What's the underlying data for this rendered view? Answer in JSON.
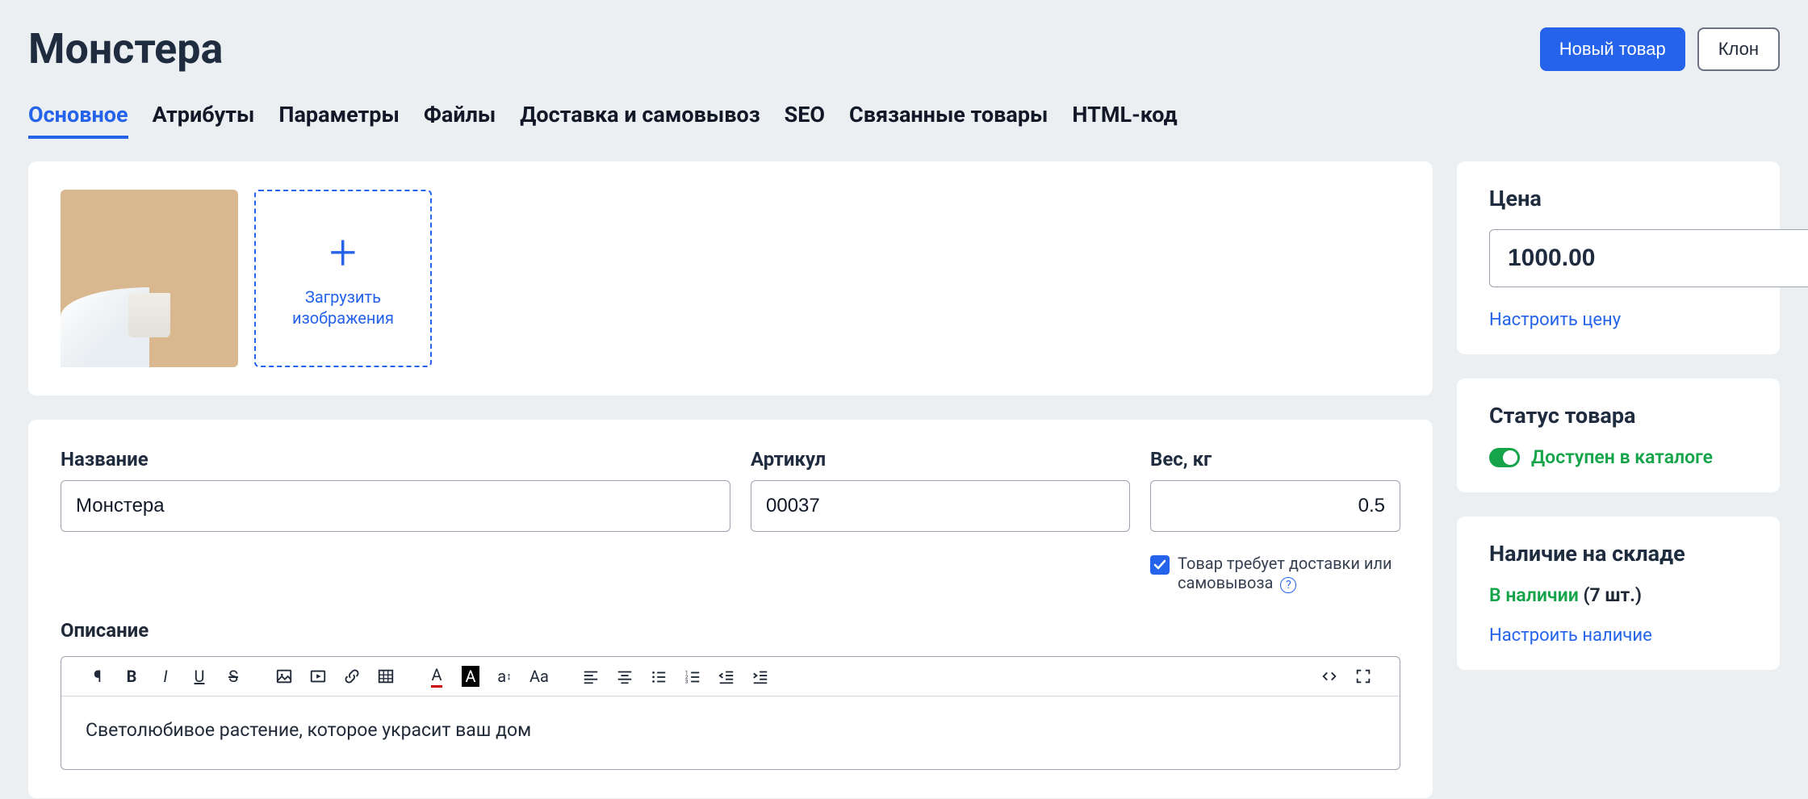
{
  "header": {
    "title": "Монстера",
    "new_button": "Новый товар",
    "clone_button": "Клон"
  },
  "tabs": [
    "Основное",
    "Атрибуты",
    "Параметры",
    "Файлы",
    "Доставка и самовывоз",
    "SEO",
    "Связанные товары",
    "HTML-код"
  ],
  "upload": {
    "label": "Загрузить изображения"
  },
  "form": {
    "name_label": "Название",
    "name_value": "Монстера",
    "sku_label": "Артикул",
    "sku_value": "00037",
    "weight_label": "Вес, кг",
    "weight_value": "0.5",
    "delivery_checkbox": "Товар требует доставки или самовывоза",
    "description_label": "Описание",
    "description_value": "Светолюбивое растение, которое украсит ваш дом"
  },
  "price": {
    "title": "Цена",
    "value": "1000.00",
    "currency": "₽",
    "configure": "Настроить цену"
  },
  "status": {
    "title": "Статус товара",
    "label": "Доступен в каталоге"
  },
  "stock": {
    "title": "Наличие на складе",
    "status_prefix": "В наличии",
    "count": "(7 шт.)",
    "configure": "Настроить наличие"
  }
}
